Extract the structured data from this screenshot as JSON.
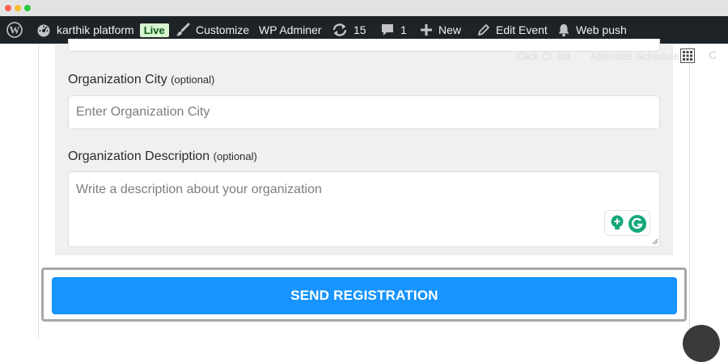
{
  "adminbar": {
    "site_name": "karthik platform",
    "live_badge": "Live",
    "customize": "Customize",
    "wp_adminer": "WP Adminer",
    "updates_count": "15",
    "comments_count": "1",
    "new": "New",
    "edit_event": "Edit Event",
    "web_push": "Web push"
  },
  "ghost_toolbar": {
    "left": "Click Cl. list",
    "right": "Attendee Scheduler"
  },
  "form": {
    "city": {
      "label": "Organization City",
      "optional": "(optional)",
      "placeholder": "Enter Organization City"
    },
    "description": {
      "label": "Organization Description",
      "optional": "(optional)",
      "placeholder": "Write a description about your organization"
    },
    "submit_label": "SEND REGISTRATION"
  },
  "colors": {
    "accent": "#1794ff",
    "adminbar_bg": "#1d2327",
    "grammarly": "#15a77a"
  }
}
